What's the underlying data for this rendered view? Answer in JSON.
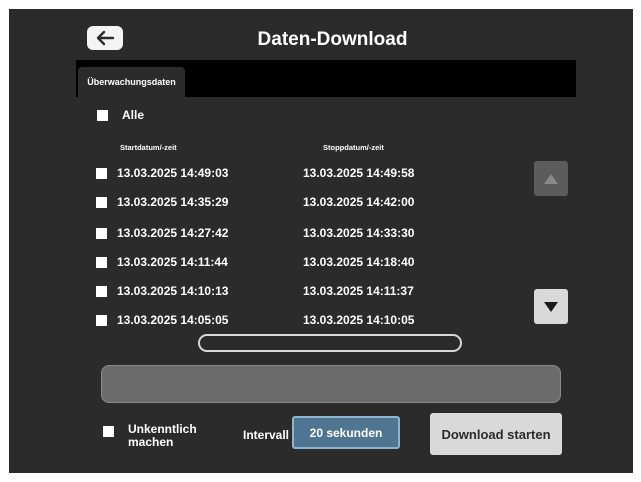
{
  "header": {
    "title": "Daten-Download",
    "back_icon": "arrow-left-icon"
  },
  "tabs": [
    {
      "label": "Überwachungsdaten",
      "active": true
    }
  ],
  "list": {
    "select_all_label": "Alle",
    "col_start": "Startdatum/-zeit",
    "col_stop": "Stoppdatum/-zeit",
    "rows": [
      {
        "start": "13.03.2025 14:49:03",
        "stop": "13.03.2025 14:49:58"
      },
      {
        "start": "13.03.2025 14:35:29",
        "stop": "13.03.2025 14:42:00"
      },
      {
        "start": "13.03.2025 14:27:42",
        "stop": "13.03.2025 14:33:30"
      },
      {
        "start": "13.03.2025 14:11:44",
        "stop": "13.03.2025 14:18:40"
      },
      {
        "start": "13.03.2025 14:10:13",
        "stop": "13.03.2025 14:11:37"
      },
      {
        "start": "13.03.2025 14:05:05",
        "stop": "13.03.2025 14:10:05"
      }
    ],
    "scroll_up_icon": "triangle-up-icon",
    "scroll_down_icon": "triangle-down-icon"
  },
  "footer": {
    "anonymize_label": "Unkenntlich machen",
    "interval_label": "Intervall",
    "interval_value": "20 sekunden",
    "download_label": "Download starten"
  },
  "colors": {
    "background": "#2b2b2b",
    "interval_button": "#4f7591",
    "download_button": "#d9d9d9"
  }
}
